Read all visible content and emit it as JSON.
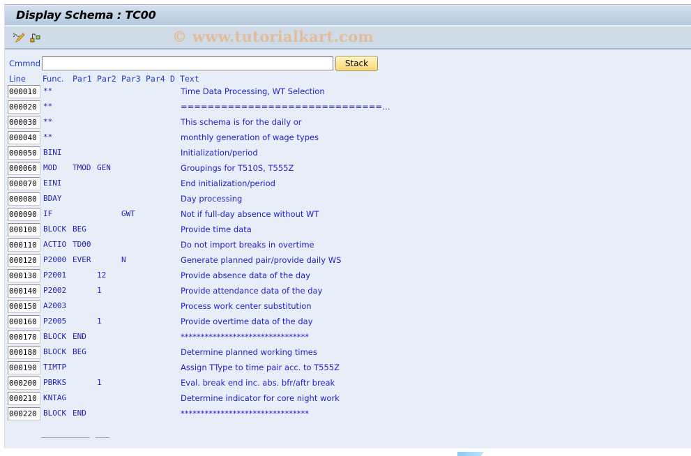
{
  "window": {
    "title": "Display Schema : TC00",
    "watermark": "© www.tutorialkart.com"
  },
  "toolbar": {
    "icons": [
      {
        "name": "display-change-icon",
        "tooltip": "Display <-> Change"
      },
      {
        "name": "other-object-icon",
        "tooltip": "Other object"
      }
    ]
  },
  "command": {
    "label": "Cmmnd",
    "value": "",
    "placeholder": "",
    "stack_label": "Stack"
  },
  "columns": {
    "line": "Line",
    "func": "Func.",
    "par1": "Par1",
    "par2": "Par2",
    "par3": "Par3",
    "par4": "Par4",
    "d": "D",
    "text": "Text"
  },
  "rows": [
    {
      "line": "000010",
      "func": "**",
      "par1": "",
      "par2": "",
      "par3": "",
      "par4": "",
      "d": "",
      "text": "Time Data Processing, WT Selection"
    },
    {
      "line": "000020",
      "func": "**",
      "par1": "",
      "par2": "",
      "par3": "",
      "par4": "",
      "d": "",
      "text": "==============================…"
    },
    {
      "line": "000030",
      "func": "**",
      "par1": "",
      "par2": "",
      "par3": "",
      "par4": "",
      "d": "",
      "text": "This schema is for the daily or"
    },
    {
      "line": "000040",
      "func": "**",
      "par1": "",
      "par2": "",
      "par3": "",
      "par4": "",
      "d": "",
      "text": "monthly generation of wage types"
    },
    {
      "line": "000050",
      "func": "BINI",
      "par1": "",
      "par2": "",
      "par3": "",
      "par4": "",
      "d": "",
      "text": "Initialization/period"
    },
    {
      "line": "000060",
      "func": "MOD",
      "par1": "TMOD",
      "par2": "GEN",
      "par3": "",
      "par4": "",
      "d": "",
      "text": "Groupings for T510S, T555Z"
    },
    {
      "line": "000070",
      "func": "EINI",
      "par1": "",
      "par2": "",
      "par3": "",
      "par4": "",
      "d": "",
      "text": "End initialization/period"
    },
    {
      "line": "000080",
      "func": "BDAY",
      "par1": "",
      "par2": "",
      "par3": "",
      "par4": "",
      "d": "",
      "text": "Day processing"
    },
    {
      "line": "000090",
      "func": "IF",
      "par1": "",
      "par2": "",
      "par3": "GWT",
      "par4": "",
      "d": "",
      "text": "Not if full-day absence without WT"
    },
    {
      "line": "000100",
      "func": "BLOCK",
      "par1": "BEG",
      "par2": "",
      "par3": "",
      "par4": "",
      "d": "",
      "text": "Provide time data"
    },
    {
      "line": "000110",
      "func": "ACTIO",
      "par1": "TD00",
      "par2": "",
      "par3": "",
      "par4": "",
      "d": "",
      "text": "Do not import breaks in overtime"
    },
    {
      "line": "000120",
      "func": "P2000",
      "par1": "EVER",
      "par2": "",
      "par3": "N",
      "par4": "",
      "d": "",
      "text": "Generate planned pair/provide daily WS"
    },
    {
      "line": "000130",
      "func": "P2001",
      "par1": "",
      "par2": "12",
      "par3": "",
      "par4": "",
      "d": "",
      "text": "Provide absence data of the day"
    },
    {
      "line": "000140",
      "func": "P2002",
      "par1": "",
      "par2": "1",
      "par3": "",
      "par4": "",
      "d": "",
      "text": "Provide attendance data of the day"
    },
    {
      "line": "000150",
      "func": "A2003",
      "par1": "",
      "par2": "",
      "par3": "",
      "par4": "",
      "d": "",
      "text": "Process work center substitution"
    },
    {
      "line": "000160",
      "func": "P2005",
      "par1": "",
      "par2": "1",
      "par3": "",
      "par4": "",
      "d": "",
      "text": "Provide overtime data of the day"
    },
    {
      "line": "000170",
      "func": "BLOCK",
      "par1": "END",
      "par2": "",
      "par3": "",
      "par4": "",
      "d": "",
      "text": "********************************"
    },
    {
      "line": "000180",
      "func": "BLOCK",
      "par1": "BEG",
      "par2": "",
      "par3": "",
      "par4": "",
      "d": "",
      "text": "Determine planned working times"
    },
    {
      "line": "000190",
      "func": "TIMTP",
      "par1": "",
      "par2": "",
      "par3": "",
      "par4": "",
      "d": "",
      "text": "Assign TType to time pair acc. to T555Z"
    },
    {
      "line": "000200",
      "func": "PBRKS",
      "par1": "",
      "par2": "1",
      "par3": "",
      "par4": "",
      "d": "",
      "text": "Eval. break end inc. abs. bfr/aftr break"
    },
    {
      "line": "000210",
      "func": "KNTAG",
      "par1": "",
      "par2": "",
      "par3": "",
      "par4": "",
      "d": "",
      "text": "Determine indicator for core night work"
    },
    {
      "line": "000220",
      "func": "BLOCK",
      "par1": "END",
      "par2": "",
      "par3": "",
      "par4": "",
      "d": "",
      "text": "********************************"
    }
  ]
}
